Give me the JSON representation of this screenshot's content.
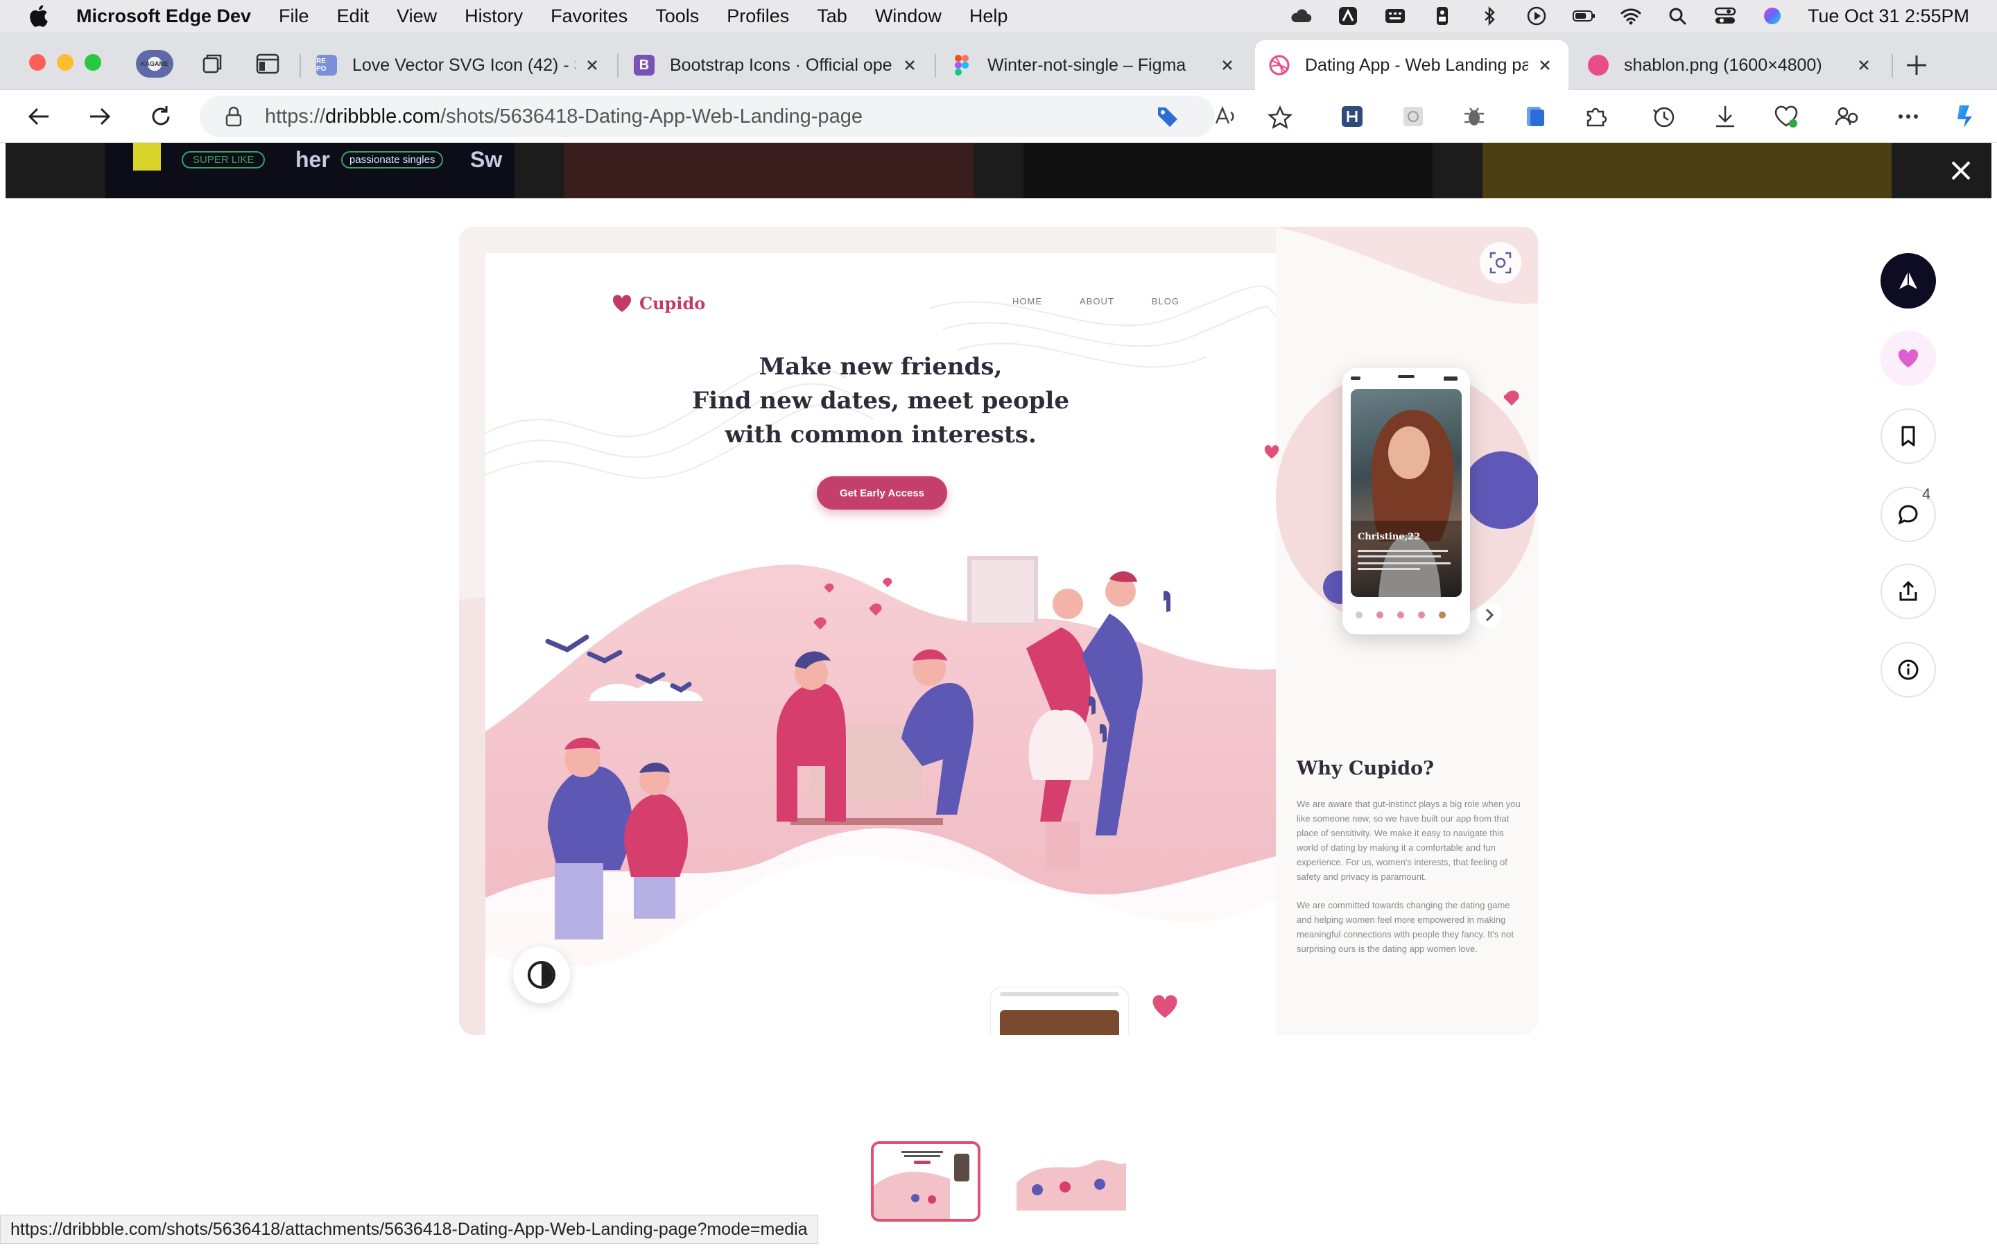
{
  "menubar": {
    "app_name": "Microsoft Edge Dev",
    "items": [
      "File",
      "Edit",
      "View",
      "History",
      "Favorites",
      "Tools",
      "Profiles",
      "Tab",
      "Window",
      "Help"
    ],
    "clock": "Tue Oct 31  2:55PM"
  },
  "tabs": [
    {
      "title": "Love Vector SVG Icon (42) - S",
      "favicon_text": "RE PO",
      "favicon_color": "#7b8fd6"
    },
    {
      "title": "Bootstrap Icons · Official ope",
      "favicon_text": "B",
      "favicon_color": "#7952b3"
    },
    {
      "title": "Winter-not-single – Figma",
      "favicon_text": "",
      "favicon_color": "#f24e1e"
    },
    {
      "title": "Dating App - Web Landing pa",
      "favicon_text": "",
      "favicon_color": "#ea4c89"
    },
    {
      "title": "shablon.png (1600×4800)",
      "favicon_text": "",
      "favicon_color": "#ea4c89"
    }
  ],
  "profile": {
    "label": "KAGAME"
  },
  "address": {
    "scheme": "https://",
    "domain": "dribbble.com",
    "path": "/shots/5636418-Dating-App-Web-Landing-page"
  },
  "shot": {
    "brand": "Cupido",
    "nav": [
      "HOME",
      "ABOUT",
      "BLOG"
    ],
    "headline": [
      "Make new friends,",
      "Find new dates, meet people",
      "with common interests."
    ],
    "cta": "Get Early Access",
    "profile_name": "Christine,22",
    "why_title": "Why Cupido?",
    "why_paragraphs": [
      "We are aware that gut-instinct plays a big role when you like someone new, so we have built our app from that place of sensitivity. We make it easy to navigate this world of dating by making it a comfortable and fun experience. For us, women's interests, that feeling of safety and privacy is paramount.",
      "We are committed towards changing the dating game and helping women feel more empowered in making meaningful connections with people they fancy. It's not surprising ours is the dating app women love."
    ],
    "banner_tags": [
      "SUPER LIKE",
      "her",
      "passionate singles",
      "Sw"
    ]
  },
  "actions": {
    "comment_count": "4"
  },
  "status_url": "https://dribbble.com/shots/5636418/attachments/5636418-Dating-App-Web-Landing-page?mode=media",
  "colors": {
    "accent": "#c43f6b",
    "like": "#e05fd0",
    "thumb_border": "#e3506f"
  }
}
